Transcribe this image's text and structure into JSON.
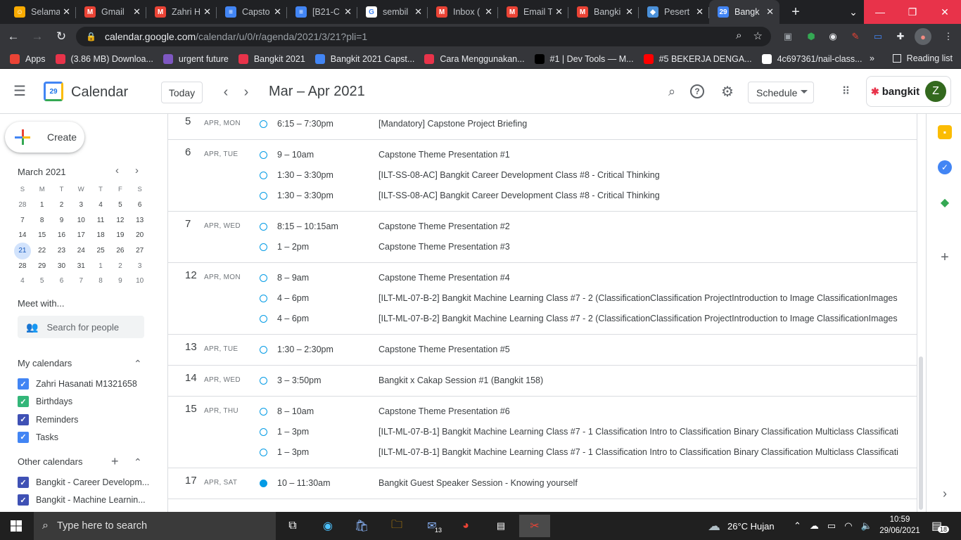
{
  "browser": {
    "tabs": [
      {
        "label": "Selama",
        "color": "#f9ab00",
        "glyph": "☺"
      },
      {
        "label": "Gmail",
        "color": "#ea4335",
        "glyph": "M"
      },
      {
        "label": "Zahri H",
        "color": "#ea4335",
        "glyph": "M"
      },
      {
        "label": "Capsto",
        "color": "#4285f4",
        "glyph": "≡"
      },
      {
        "label": "[B21-C",
        "color": "#4285f4",
        "glyph": "≡"
      },
      {
        "label": "sembil",
        "color": "#ffffff",
        "glyph": "G"
      },
      {
        "label": "Inbox (",
        "color": "#ea4335",
        "glyph": "M"
      },
      {
        "label": "Email T",
        "color": "#ea4335",
        "glyph": "M"
      },
      {
        "label": "Bangki",
        "color": "#ea4335",
        "glyph": "M"
      },
      {
        "label": "Pesert",
        "color": "#4a90d9",
        "glyph": "◆"
      },
      {
        "label": "Bangk",
        "color": "#4285f4",
        "glyph": "29",
        "active": true
      }
    ],
    "url_host": "calendar.google.com",
    "url_path": "/calendar/u/0/r/agenda/2021/3/21?pli=1",
    "bookmarks": [
      {
        "label": "Apps",
        "color": "#ea4335"
      },
      {
        "label": "(3.86 MB) Downloa...",
        "color": "#e8334a"
      },
      {
        "label": "urgent future",
        "color": "#7e57c2"
      },
      {
        "label": "Bangkit 2021",
        "color": "#e8334a"
      },
      {
        "label": "Bangkit 2021 Capst...",
        "color": "#4285f4"
      },
      {
        "label": "Cara Menggunakan...",
        "color": "#e8334a"
      },
      {
        "label": "#1 | Dev Tools — M...",
        "color": "#000000"
      },
      {
        "label": "#5 BEKERJA DENGA...",
        "color": "#ff0000"
      },
      {
        "label": "4c697361/nail-class...",
        "color": "#ffffff"
      }
    ],
    "reading_list": "Reading list",
    "more_bookmarks": "»"
  },
  "header": {
    "app_name": "Calendar",
    "logo_day": "29",
    "today_label": "Today",
    "date_range": "Mar – Apr 2021",
    "view_label": "Schedule",
    "brand": "bangkit",
    "avatar_initial": "Z"
  },
  "sidebar": {
    "create_label": "Create",
    "mini_month": "March 2021",
    "dow": [
      "S",
      "M",
      "T",
      "W",
      "T",
      "F",
      "S"
    ],
    "weeks": [
      [
        "28",
        "1",
        "2",
        "3",
        "4",
        "5",
        "6"
      ],
      [
        "7",
        "8",
        "9",
        "10",
        "11",
        "12",
        "13"
      ],
      [
        "14",
        "15",
        "16",
        "17",
        "18",
        "19",
        "20"
      ],
      [
        "21",
        "22",
        "23",
        "24",
        "25",
        "26",
        "27"
      ],
      [
        "28",
        "29",
        "30",
        "31",
        "1",
        "2",
        "3"
      ],
      [
        "4",
        "5",
        "6",
        "7",
        "8",
        "9",
        "10"
      ]
    ],
    "selected_day": "21",
    "meet_with": "Meet with...",
    "search_people_placeholder": "Search for people",
    "my_calendars_title": "My calendars",
    "my_calendars": [
      {
        "label": "Zahri Hasanati M1321658",
        "color": "#4285f4"
      },
      {
        "label": "Birthdays",
        "color": "#33b679"
      },
      {
        "label": "Reminders",
        "color": "#3f51b5"
      },
      {
        "label": "Tasks",
        "color": "#4285f4"
      }
    ],
    "other_calendars_title": "Other calendars",
    "other_calendars": [
      {
        "label": "Bangkit - Career Developm...",
        "color": "#3f51b5"
      },
      {
        "label": "Bangkit - Machine Learnin...",
        "color": "#3f51b5"
      }
    ]
  },
  "agenda": [
    {
      "day": "5",
      "label": "APR, MON",
      "events": [
        {
          "time": "6:15 – 7:30pm",
          "title": "[Mandatory] Capstone Project Briefing"
        }
      ]
    },
    {
      "day": "6",
      "label": "APR, TUE",
      "events": [
        {
          "time": "9 – 10am",
          "title": "Capstone Theme Presentation #1"
        },
        {
          "time": "1:30 – 3:30pm",
          "title": "[ILT-SS-08-AC] Bangkit Career Development Class #8 - Critical Thinking"
        },
        {
          "time": "1:30 – 3:30pm",
          "title": "[ILT-SS-08-AC] Bangkit Career Development Class #8 - Critical Thinking"
        }
      ]
    },
    {
      "day": "7",
      "label": "APR, WED",
      "events": [
        {
          "time": "8:15 – 10:15am",
          "title": "Capstone Theme Presentation #2"
        },
        {
          "time": "1 – 2pm",
          "title": "Capstone Theme Presentation #3"
        }
      ]
    },
    {
      "day": "12",
      "label": "APR, MON",
      "events": [
        {
          "time": "8 – 9am",
          "title": "Capstone Theme Presentation #4"
        },
        {
          "time": "4 – 6pm",
          "title": "[ILT-ML-07-B-2] Bangkit Machine Learning Class #7 - 2 (ClassificationClassification ProjectIntroduction to Image ClassificationImages"
        },
        {
          "time": "4 – 6pm",
          "title": "[ILT-ML-07-B-2] Bangkit Machine Learning Class #7 - 2 (ClassificationClassification ProjectIntroduction to Image ClassificationImages"
        }
      ]
    },
    {
      "day": "13",
      "label": "APR, TUE",
      "events": [
        {
          "time": "1:30 – 2:30pm",
          "title": "Capstone Theme Presentation #5"
        }
      ]
    },
    {
      "day": "14",
      "label": "APR, WED",
      "events": [
        {
          "time": "3 – 3:50pm",
          "title": "Bangkit x Cakap Session #1 (Bangkit 158)"
        }
      ]
    },
    {
      "day": "15",
      "label": "APR, THU",
      "events": [
        {
          "time": "8 – 10am",
          "title": "Capstone Theme Presentation #6"
        },
        {
          "time": "1 – 3pm",
          "title": "[ILT-ML-07-B-1] Bangkit Machine Learning Class #7 - 1 Classification Intro to Classification Binary Classification Multiclass Classificati"
        },
        {
          "time": "1 – 3pm",
          "title": "[ILT-ML-07-B-1] Bangkit Machine Learning Class #7 - 1 Classification Intro to Classification Binary Classification Multiclass Classificati"
        }
      ]
    },
    {
      "day": "17",
      "label": "APR, SAT",
      "events": [
        {
          "time": "10 – 11:30am",
          "title": "Bangkit Guest Speaker Session - Knowing yourself",
          "filled": true
        }
      ]
    }
  ],
  "taskbar": {
    "search_placeholder": "Type here to search",
    "mail_badge": "13",
    "weather": "26°C  Hujan",
    "time": "10:59",
    "date": "29/06/2021",
    "notification_count": "18"
  }
}
